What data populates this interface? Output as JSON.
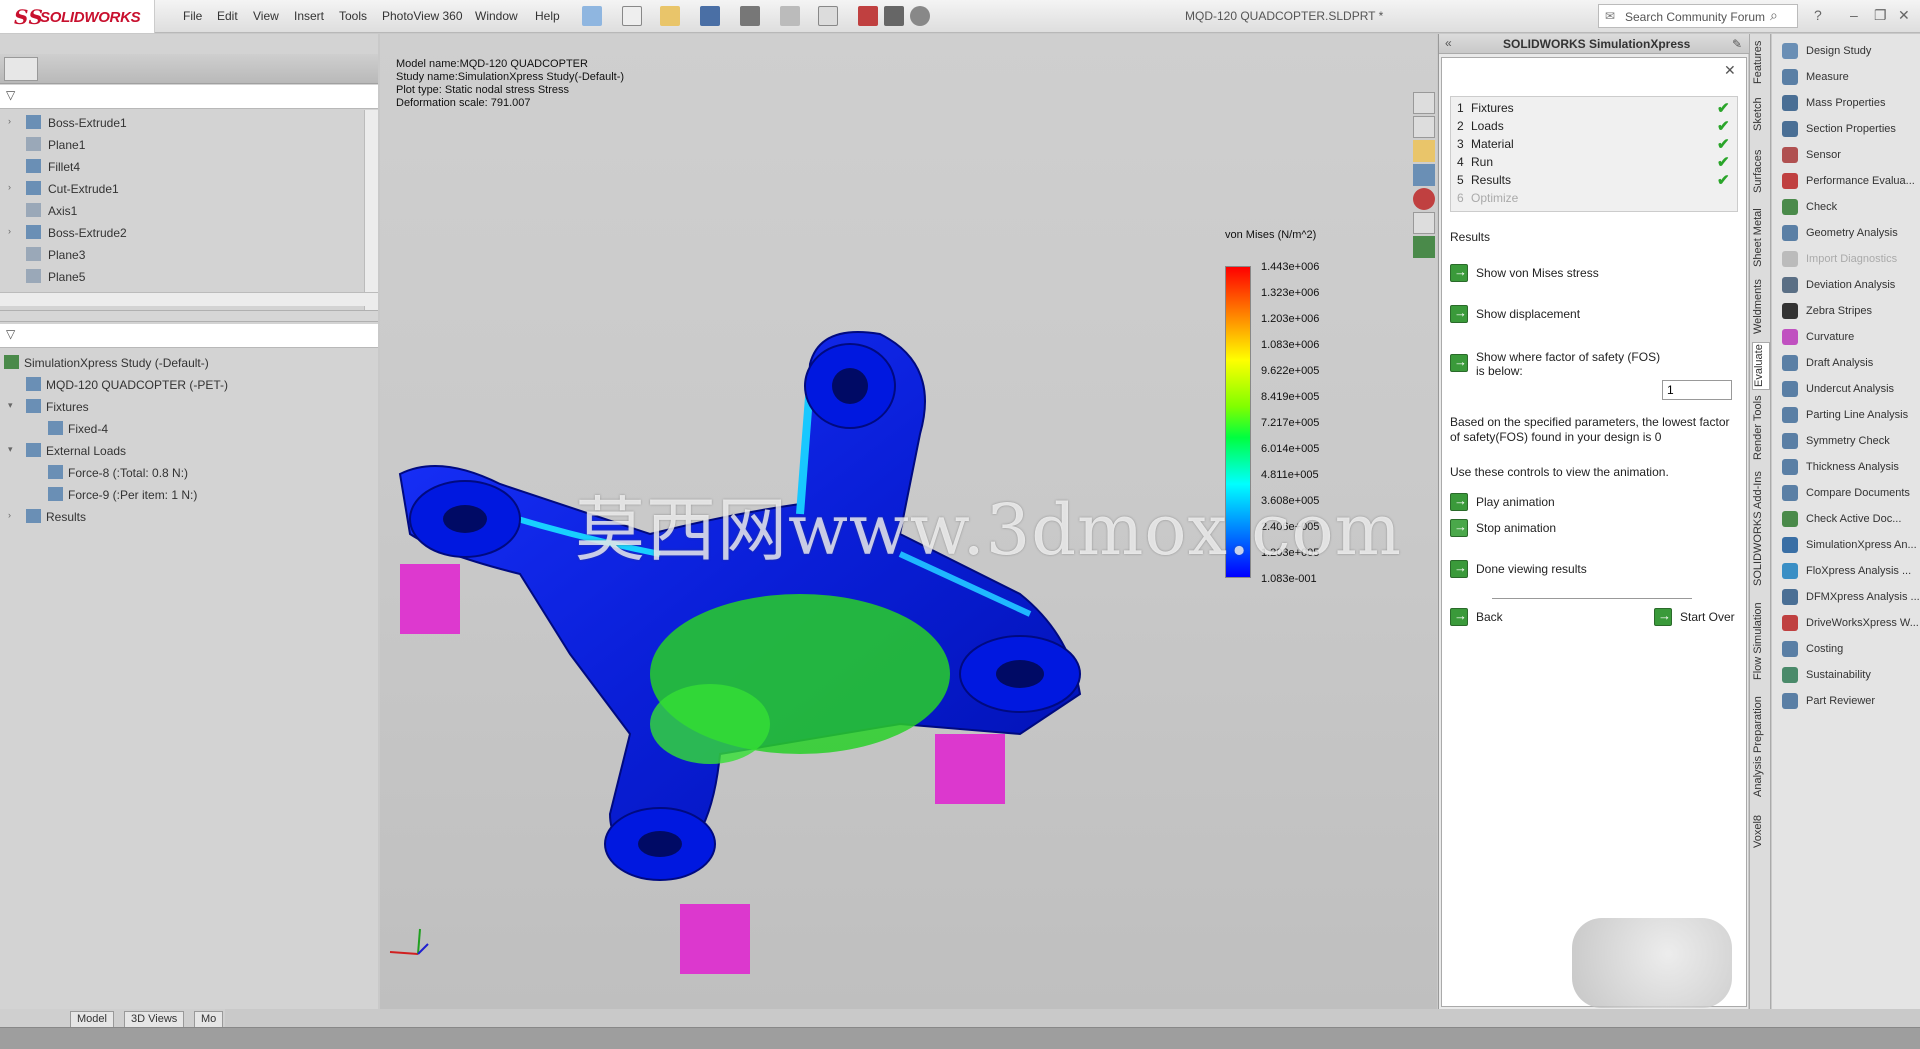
{
  "app": {
    "logo_mark": "ЅS",
    "logo_name": "SOLIDWORKS",
    "document_title": "MQD-120 QUADCOPTER.SLDPRT *"
  },
  "menu": [
    "File",
    "Edit",
    "View",
    "Insert",
    "Tools",
    "PhotoView 360",
    "Window",
    "Help"
  ],
  "search": {
    "placeholder": "Search Community Forum"
  },
  "feature_tree": [
    {
      "label": "Boss-Extrude1",
      "expandable": true
    },
    {
      "label": "Plane1",
      "expandable": false
    },
    {
      "label": "Fillet4",
      "expandable": false
    },
    {
      "label": "Cut-Extrude1",
      "expandable": true
    },
    {
      "label": "Axis1",
      "expandable": false
    },
    {
      "label": "Boss-Extrude2",
      "expandable": true
    },
    {
      "label": "Plane3",
      "expandable": false
    },
    {
      "label": "Plane5",
      "expandable": false
    }
  ],
  "study_tree": [
    {
      "label": "SimulationXpress Study (-Default-)",
      "level": 0,
      "arrow": ""
    },
    {
      "label": "MQD-120 QUADCOPTER (-PET-)",
      "level": 1,
      "arrow": ""
    },
    {
      "label": "Fixtures",
      "level": 1,
      "arrow": "▾"
    },
    {
      "label": "Fixed-4",
      "level": 2,
      "arrow": ""
    },
    {
      "label": "External Loads",
      "level": 1,
      "arrow": "▾"
    },
    {
      "label": "Force-8 (:Total: 0.8 N:)",
      "level": 2,
      "arrow": ""
    },
    {
      "label": "Force-9 (:Per item: 1 N:)",
      "level": 2,
      "arrow": ""
    },
    {
      "label": "Results",
      "level": 1,
      "arrow": "›"
    }
  ],
  "viewport": {
    "info": [
      "Model name:MQD-120 QUADCOPTER",
      "Study name:SimulationXpress Study(-Default-)",
      "Plot type: Static nodal stress Stress",
      "Deformation scale: 791.007"
    ],
    "legend_title": "von Mises (N/m^2)",
    "legend_values": [
      "1.443e+006",
      "1.323e+006",
      "1.203e+006",
      "1.083e+006",
      "9.622e+005",
      "8.419e+005",
      "7.217e+005",
      "6.014e+005",
      "4.811e+005",
      "3.608e+005",
      "2.406e+005",
      "1.203e+005",
      "1.083e-001"
    ],
    "watermark": "莫西网www.3dmox.com"
  },
  "simxpress": {
    "title": "SOLIDWORKS SimulationXpress",
    "steps": [
      {
        "num": "1",
        "label": "Fixtures",
        "done": true
      },
      {
        "num": "2",
        "label": "Loads",
        "done": true
      },
      {
        "num": "3",
        "label": "Material",
        "done": true
      },
      {
        "num": "4",
        "label": "Run",
        "done": true
      },
      {
        "num": "5",
        "label": "Results",
        "done": true
      },
      {
        "num": "6",
        "label": "Optimize",
        "done": false
      }
    ],
    "results_heading": "Results",
    "show_von_mises": "Show von Mises stress",
    "show_displacement": "Show displacement",
    "show_fos": "Show where factor of safety (FOS) is below:",
    "fos_value": "1",
    "fos_message": "Based on the specified parameters, the lowest factor of safety(FOS) found in your design is 0",
    "animation_hint": "Use these controls to view the animation.",
    "play_animation": "Play animation",
    "stop_animation": "Stop animation",
    "done_viewing": "Done viewing results",
    "back": "Back",
    "start_over": "Start Over"
  },
  "vertical_tabs": [
    "Features",
    "Sketch",
    "Surfaces",
    "Sheet Metal",
    "Weldments",
    "Evaluate",
    "Render Tools",
    "SOLIDWORKS Add-Ins",
    "Flow Simulation",
    "Analysis Preparation",
    "Voxel8"
  ],
  "evaluate_commands": [
    {
      "label": "Design Study",
      "color": "#6a8fb5",
      "dim": false
    },
    {
      "label": "Measure",
      "color": "#5a7fa5",
      "dim": false
    },
    {
      "label": "Mass Properties",
      "color": "#4a6f95",
      "dim": false
    },
    {
      "label": "Section Properties",
      "color": "#4a6f95",
      "dim": false
    },
    {
      "label": "Sensor",
      "color": "#b05050",
      "dim": false
    },
    {
      "label": "Performance Evalua...",
      "color": "#c04040",
      "dim": false
    },
    {
      "label": "Check",
      "color": "#4a8a4a",
      "dim": false
    },
    {
      "label": "Geometry Analysis",
      "color": "#5a7fa5",
      "dim": false
    },
    {
      "label": "Import Diagnostics",
      "color": "#bbbbbb",
      "dim": true
    },
    {
      "label": "Deviation Analysis",
      "color": "#5a6f85",
      "dim": false
    },
    {
      "label": "Zebra Stripes",
      "color": "#333333",
      "dim": false
    },
    {
      "label": "Curvature",
      "color": "#c050c0",
      "dim": false
    },
    {
      "label": "Draft Analysis",
      "color": "#5a7fa5",
      "dim": false
    },
    {
      "label": "Undercut Analysis",
      "color": "#5a7fa5",
      "dim": false
    },
    {
      "label": "Parting Line Analysis",
      "color": "#5a7fa5",
      "dim": false
    },
    {
      "label": "Symmetry Check",
      "color": "#5a7fa5",
      "dim": false
    },
    {
      "label": "Thickness Analysis",
      "color": "#5a7fa5",
      "dim": false
    },
    {
      "label": "Compare Documents",
      "color": "#5a7fa5",
      "dim": false
    },
    {
      "label": "Check Active Doc...",
      "color": "#4a8a4a",
      "dim": false
    },
    {
      "label": "SimulationXpress An...",
      "color": "#3a6fa5",
      "dim": false
    },
    {
      "label": "FloXpress Analysis ...",
      "color": "#3a8fc5",
      "dim": false
    },
    {
      "label": "DFMXpress Analysis ...",
      "color": "#4a6f95",
      "dim": false
    },
    {
      "label": "DriveWorksXpress W...",
      "color": "#c04040",
      "dim": false
    },
    {
      "label": "Costing",
      "color": "#5a7fa5",
      "dim": false
    },
    {
      "label": "Sustainability",
      "color": "#4a8a6a",
      "dim": false
    },
    {
      "label": "Part Reviewer",
      "color": "#5a7fa5",
      "dim": false
    }
  ],
  "bottom_tabs": [
    "Model",
    "3D Views",
    "Mo"
  ]
}
